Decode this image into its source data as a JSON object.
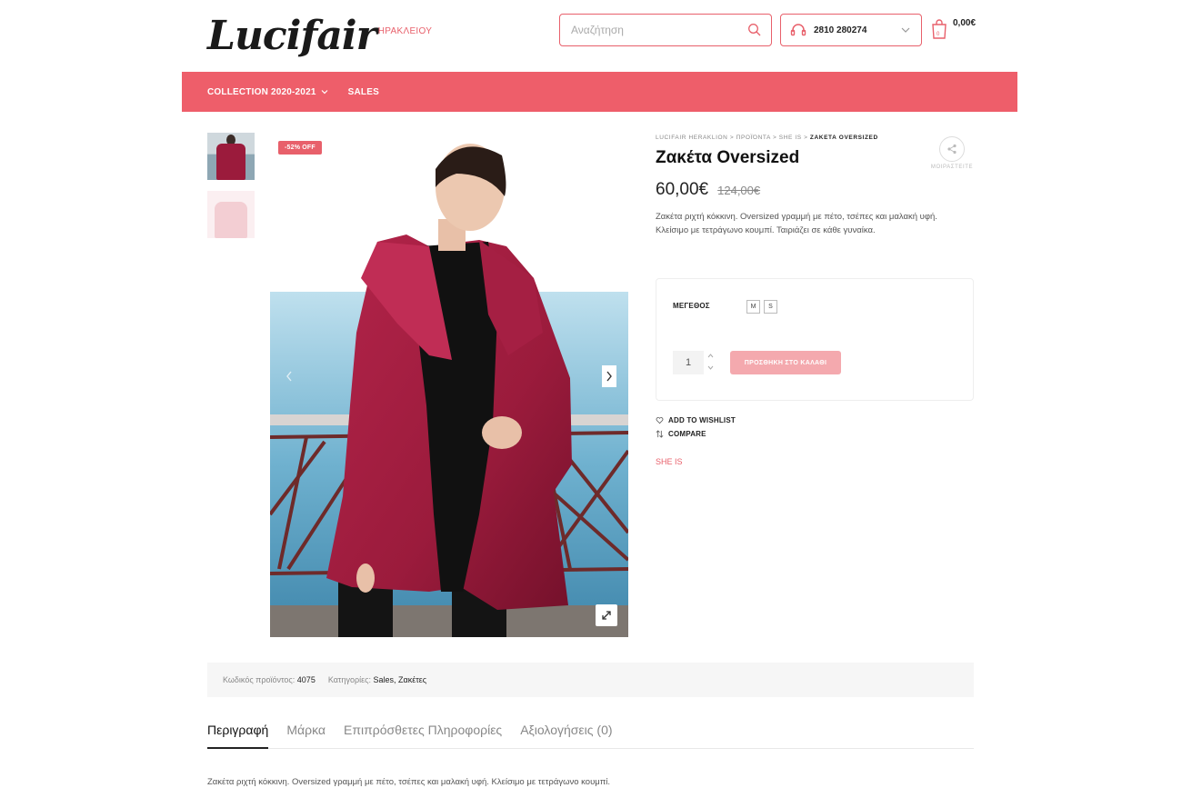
{
  "header": {
    "logo_script": "Lucifair",
    "logo_sub": "ΗΡΑΚΛΕΙΟΥ",
    "search_placeholder": "Αναζήτηση",
    "phone": "2810 280274",
    "cart_total": "0,00€"
  },
  "nav": {
    "items": [
      {
        "label": "COLLECTION 2020-2021",
        "has_dropdown": true
      },
      {
        "label": "SALES",
        "has_dropdown": false
      }
    ]
  },
  "gallery": {
    "sale_badge": "-52% OFF",
    "thumbnail_count": 2
  },
  "product": {
    "breadcrumb": [
      "LUCIFAIR HERAKLION",
      "ΠΡΟΪΌΝΤΑ",
      "SHE IS",
      "ΖΑΚΕΤΑ OVERSIZED"
    ],
    "share_label": "ΜΟΙΡΑΣΤΕΙΤΕ",
    "title": "Ζακέτα Oversized",
    "price": "60,00€",
    "old_price": "124,00€",
    "short_description": "Ζακέτα ριχτή κόκκινη. Oversized γραμμή με πέτο, τσέπες και μαλακή υφή. Κλείσιμο με τετράγωνο κουμπί. Ταιριάζει σε κάθε γυναίκα.",
    "size_label": "ΜΕΓΕΘΟΣ",
    "sizes": [
      "M",
      "S"
    ],
    "quantity": "1",
    "add_to_cart": "ΠΡΟΣΘΗΚΗ ΣΤΟ ΚΑΛΑΘΙ",
    "wishlist": "ADD TO WISHLIST",
    "compare": "COMPARE",
    "brand": "SHE IS"
  },
  "meta": {
    "sku_label": "Κωδικός προϊόντος:",
    "sku": "4075",
    "categories_label": "Κατηγορίες:",
    "categories": [
      "Sales",
      "Ζακέτες"
    ]
  },
  "tabs": {
    "items": [
      "Περιγραφή",
      "Μάρκα",
      "Επιπρόσθετες Πληροφορίες",
      "Αξιολογήσεις (0)"
    ],
    "active": "Περιγραφή",
    "description": "Ζακέτα ριχτή κόκκινη. Oversized γραμμή με πέτο, τσέπες και μαλακή υφή.  Κλείσιμο με τετράγωνο κουμπί."
  },
  "colors": {
    "accent": "#ee5e6a",
    "coat": "#9b1b3c",
    "button_disabled": "#f4a9ae"
  }
}
